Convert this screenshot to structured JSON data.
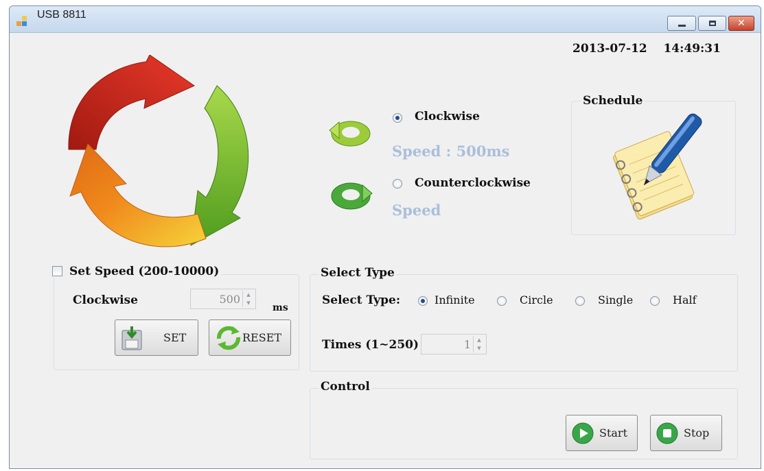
{
  "window": {
    "title": "USB 8811"
  },
  "datetime": {
    "date": "2013-07-12",
    "time": "14:49:31"
  },
  "direction": {
    "clockwise_label": "Clockwise",
    "clockwise_selected": true,
    "clockwise_speed": "Speed : 500ms",
    "counterclockwise_label": "Counterclockwise",
    "counterclockwise_selected": false,
    "counterclockwise_speed": "Speed"
  },
  "schedule": {
    "title": "Schedule"
  },
  "set_speed": {
    "checkbox_label": "Set Speed (200-10000)",
    "checked": false,
    "direction_label": "Clockwise",
    "value": "500",
    "unit": "ms",
    "set_button": "SET",
    "reset_button": "RESET"
  },
  "select_type": {
    "group_title": "Select Type",
    "label": "Select Type:",
    "options": [
      {
        "label": "Infinite",
        "selected": true
      },
      {
        "label": "Circle",
        "selected": false
      },
      {
        "label": "Single",
        "selected": false
      },
      {
        "label": "Half",
        "selected": false
      }
    ],
    "times_label": "Times (1~250)",
    "times_value": "1"
  },
  "control": {
    "group_title": "Control",
    "start_button": "Start",
    "stop_button": "Stop"
  },
  "colors": {
    "arrow_red": "#d32a1c",
    "arrow_orange": "#f08a1c",
    "arrow_yellow": "#f6d33a",
    "arrow_green": "#7cc23a",
    "speed_text": "#a9bfda",
    "titlebar": "#d0e0f2",
    "close_button": "#c6432a"
  },
  "icons": [
    "app-icon",
    "minimize-icon",
    "maximize-icon",
    "close-icon",
    "rotation-arrows-icon",
    "clockwise-icon",
    "counterclockwise-icon",
    "schedule-notepad-pen-icon",
    "save-icon",
    "refresh-icon",
    "play-icon",
    "stop-icon"
  ]
}
